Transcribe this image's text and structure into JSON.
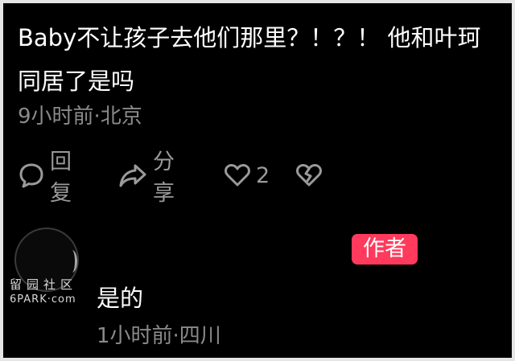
{
  "comment": {
    "line1": "Baby不让孩子去他们那里？！？！ 他和叶珂",
    "line2": "同居了是吗",
    "meta": "9小时前·北京"
  },
  "actions": {
    "reply_label": "回复",
    "share_label": "分享",
    "like_count": "2"
  },
  "reply": {
    "author_badge": "作者",
    "text": "是的",
    "meta": "1小时前·四川"
  },
  "watermark": {
    "line1": "留园社区",
    "line2": "6PARK·com"
  },
  "colors": {
    "background": "#000000",
    "primary_text": "#ffffff",
    "secondary_text": "#8a8a8a",
    "badge": "#ff3a5c"
  },
  "icons": [
    "reply-bubble-icon",
    "share-arrow-icon",
    "heart-icon",
    "broken-heart-icon"
  ]
}
